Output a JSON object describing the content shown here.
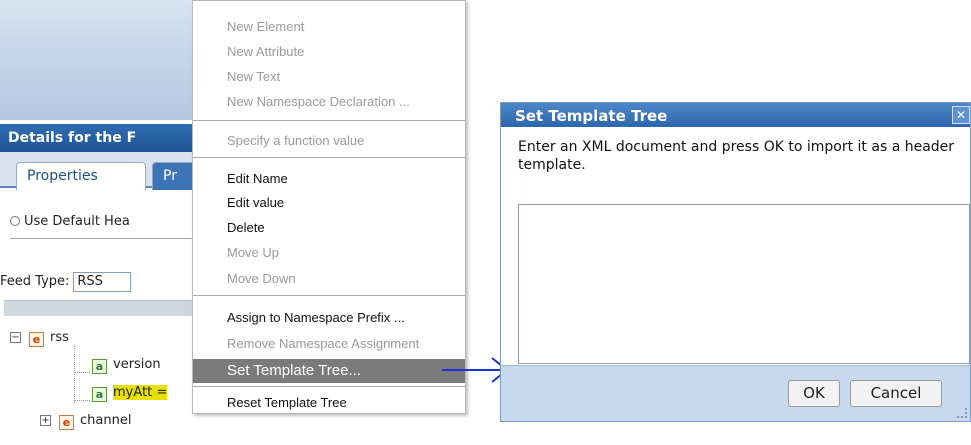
{
  "background_app": {
    "panel_title": "Details for the F",
    "tabs": [
      {
        "label": "Properties"
      },
      {
        "label": "Pr"
      }
    ],
    "radio_label": "Use Default Hea",
    "feed_type_label": "Feed Type:",
    "feed_type_value": "RSS",
    "tree": {
      "rss": "rss",
      "version": "version",
      "myAtt": "myAtt =",
      "channel": "channel",
      "element_badge": "e",
      "attribute_badge": "a",
      "collapse_glyph": "−",
      "expand_glyph": "+"
    }
  },
  "context_menu": {
    "new_element": "New Element",
    "new_attribute": "New Attribute",
    "new_text": "New Text",
    "new_namespace_declaration": "New Namespace Declaration ...",
    "specify_function_value": "Specify a function value",
    "edit_name": "Edit Name",
    "edit_value": "Edit value",
    "delete": "Delete",
    "move_up": "Move Up",
    "move_down": "Move Down",
    "assign_namespace_prefix": "Assign to Namespace Prefix ...",
    "remove_namespace_assignment": "Remove Namespace Assignment",
    "set_template_tree": "Set Template Tree...",
    "reset_template_tree": "Reset Template Tree"
  },
  "dialog": {
    "title": "Set Template Tree",
    "close_glyph": "✕",
    "message": "Enter an XML document and press OK to import it as a header template.",
    "textarea_value": "",
    "ok_label": "OK",
    "cancel_label": "Cancel"
  },
  "colors": {
    "header_blue": "#2f6db2",
    "menu_highlight": "#7b7b7b",
    "arrow_blue": "#1a2fd6",
    "dialog_footer": "#c6d9ee"
  }
}
